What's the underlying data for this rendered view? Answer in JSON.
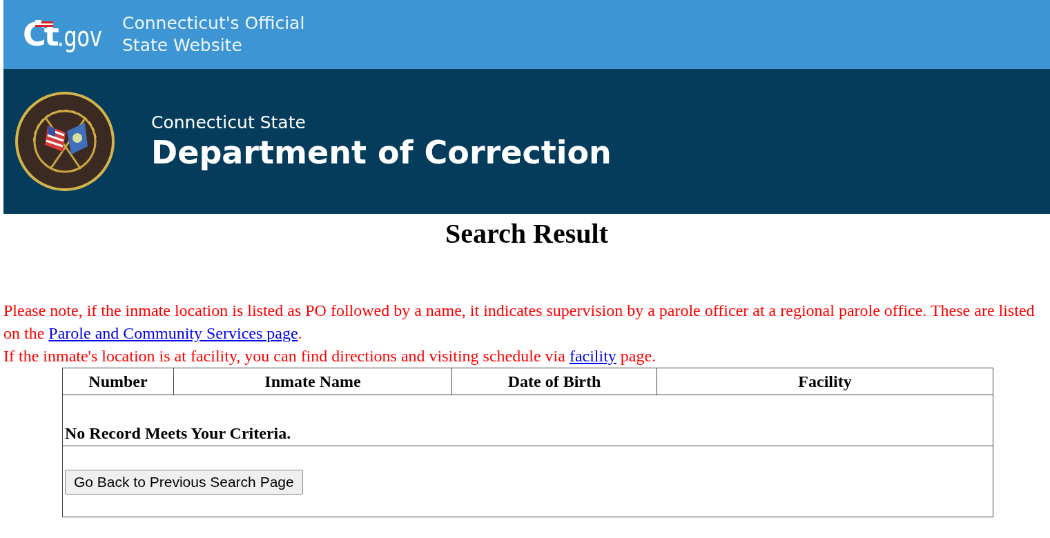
{
  "top_bar": {
    "logo_main": "Ct",
    "logo_suffix": ".gov",
    "tagline_lines": [
      "Connecticut's Official",
      "State Website"
    ]
  },
  "agency_banner": {
    "kicker": "Connecticut State",
    "title": "Department of Correction"
  },
  "page_title": "Search Result",
  "notes": [
    {
      "before": "Please note, if the inmate location is listed as PO followed by a name, it indicates supervision by a parole officer at a regional parole office. These are listed on the ",
      "link": "Parole and Community Services page",
      "after": "."
    },
    {
      "before": "If the inmate's location is at facility, you can find directions and visiting schedule via ",
      "link": "facility",
      "after": " page."
    }
  ],
  "table": {
    "columns": [
      "Number",
      "Inmate Name",
      "Date of Birth",
      "Facility"
    ],
    "empty_message": "No Record Meets Your Criteria.",
    "back_button": "Go Back to Previous Search Page"
  }
}
